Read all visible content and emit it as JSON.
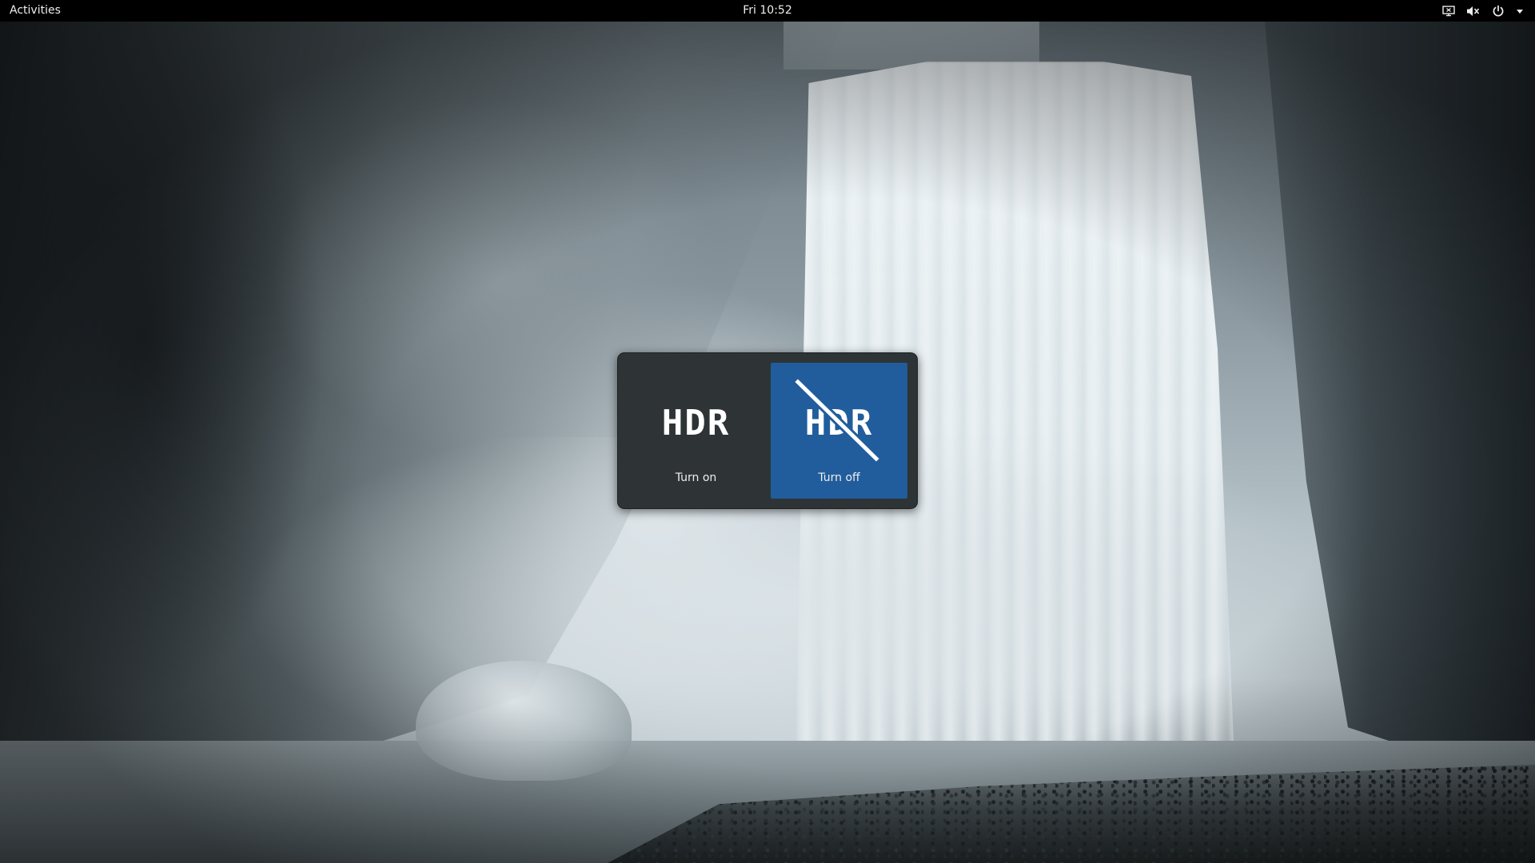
{
  "topbar": {
    "activities": "Activities",
    "clock": "Fri 10:52",
    "status_icons": [
      "screen-share-icon",
      "volume-muted-icon",
      "power-icon",
      "dropdown-arrow-icon"
    ]
  },
  "hdr_switcher": {
    "options": [
      {
        "glyph": "HDR",
        "label": "Turn on",
        "selected": false,
        "icon": "hdr-on-icon"
      },
      {
        "glyph": "HDR",
        "label": "Turn off",
        "selected": true,
        "icon": "hdr-off-icon"
      }
    ]
  },
  "colors": {
    "topbar_bg": "#000000",
    "popup_bg": "#2e3436",
    "selected_bg": "#215d9c",
    "text": "#eeeeec"
  }
}
